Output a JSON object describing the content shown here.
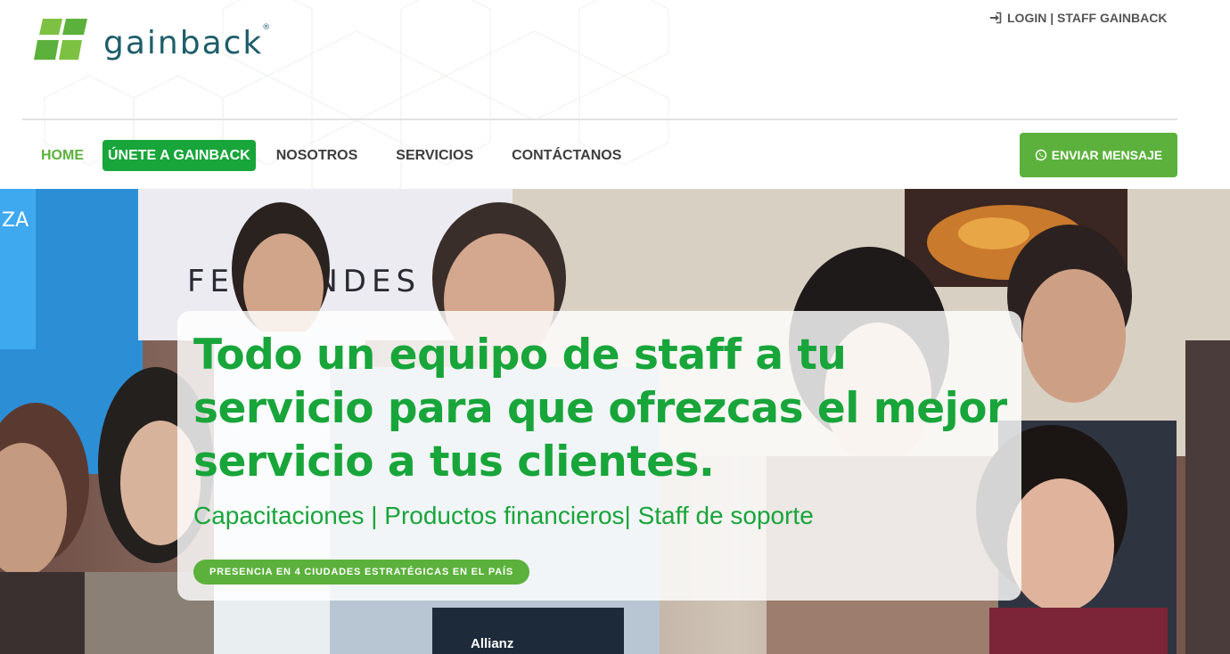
{
  "brand": {
    "name": "gainback",
    "registered_mark": "®",
    "colors": {
      "logo_green": "#5bb13b",
      "logo_teal": "#1e5d6b",
      "accent_green": "#18a53a"
    }
  },
  "top_bar": {
    "login_label": "LOGIN | STAFF GAINBACK",
    "login_icon": "sign-in-icon"
  },
  "nav": {
    "items": [
      {
        "label": "HOME",
        "state": "active"
      },
      {
        "label": "ÚNETE A GAINBACK",
        "state": "highlight"
      },
      {
        "label": "NOSOTROS",
        "state": "normal"
      },
      {
        "label": "SERVICIOS",
        "state": "normal"
      },
      {
        "label": "CONTÁCTANOS",
        "state": "normal"
      }
    ],
    "cta": {
      "label": "ENVIAR MENSAJE",
      "icon": "whatsapp-icon"
    }
  },
  "hero": {
    "title": "Todo un equipo de staff a tu servicio para que ofrezcas el mejor servicio a tus clientes.",
    "subtitle": "Capacitaciones | Productos financieros| Staff de soporte",
    "badge": "PRESENCIA EN 4 CIUDADES ESTRATÉGICAS EN EL PAÍS",
    "photo_sign_text": "FERNANDES",
    "photo_sign_text_left": "ZA",
    "photo_plaque_text": "Allianz"
  }
}
